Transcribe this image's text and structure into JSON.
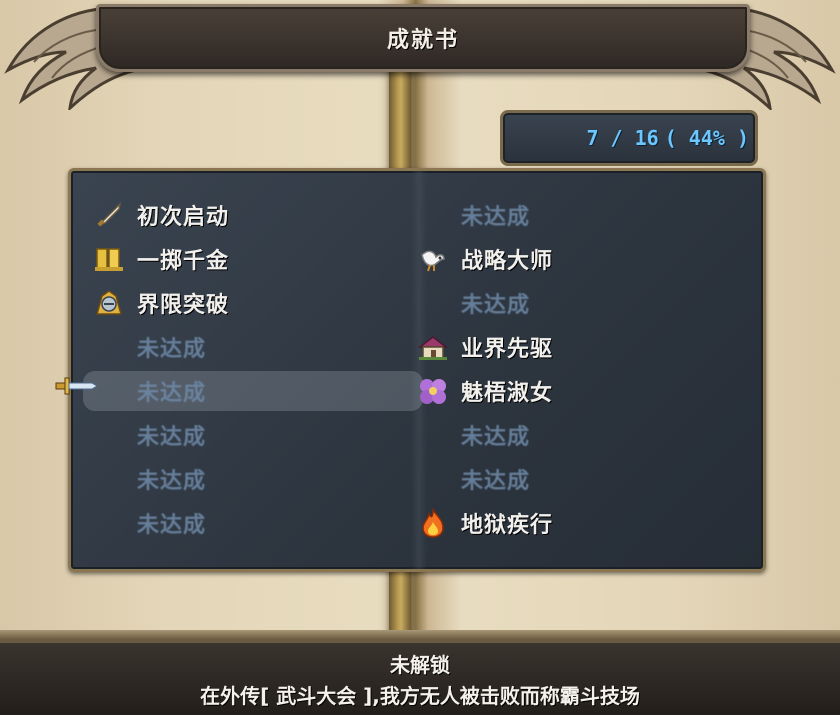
{
  "header": {
    "title": "成就书"
  },
  "progress": {
    "count": "7 / 16",
    "percent": "( 44% )"
  },
  "achievements": {
    "left": [
      {
        "label": "初次启动",
        "icon": "sword-icon",
        "unlocked": true
      },
      {
        "label": "一掷千金",
        "icon": "gold-bars-icon",
        "unlocked": true
      },
      {
        "label": "界限突破",
        "icon": "knight-helmet-icon",
        "unlocked": true
      },
      {
        "label": "未达成",
        "icon": "",
        "unlocked": false
      },
      {
        "label": "未达成",
        "icon": "",
        "unlocked": false
      },
      {
        "label": "未达成",
        "icon": "",
        "unlocked": false
      },
      {
        "label": "未达成",
        "icon": "",
        "unlocked": false
      },
      {
        "label": "未达成",
        "icon": "",
        "unlocked": false
      }
    ],
    "right": [
      {
        "label": "未达成",
        "icon": "",
        "unlocked": false
      },
      {
        "label": "战略大师",
        "icon": "white-bird-icon",
        "unlocked": true
      },
      {
        "label": "未达成",
        "icon": "",
        "unlocked": false
      },
      {
        "label": "业界先驱",
        "icon": "house-icon",
        "unlocked": true
      },
      {
        "label": "魅梧淑女",
        "icon": "purple-flower-icon",
        "unlocked": true
      },
      {
        "label": "未达成",
        "icon": "",
        "unlocked": false
      },
      {
        "label": "未达成",
        "icon": "",
        "unlocked": false
      },
      {
        "label": "地狱疾行",
        "icon": "fire-icon",
        "unlocked": true
      }
    ]
  },
  "selected": {
    "column": "left",
    "index": 4
  },
  "info": {
    "status": "未解锁",
    "description": "在外传[ 武斗大会 ],我方无人被击败而称霸斗技场"
  },
  "colors": {
    "unlocked_text": "#f2f0ec",
    "locked_text": "#6f8aa8",
    "counter_text": "#6cc6ff",
    "panel_bg": "#2c343e"
  }
}
